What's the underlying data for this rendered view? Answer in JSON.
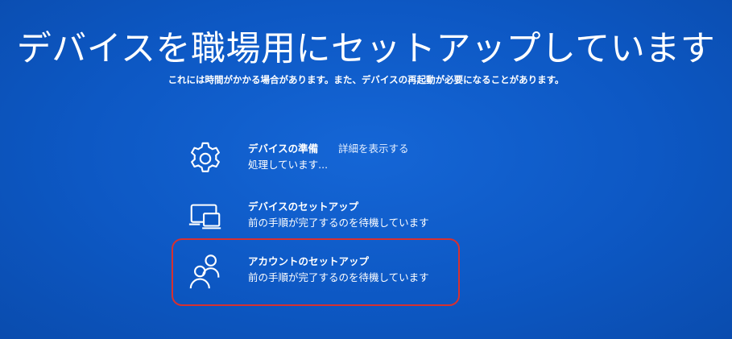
{
  "header": {
    "title": "デバイスを職場用にセットアップしています",
    "subtitle": "これには時間がかかる場合があります。また、デバイスの再起動が必要になることがあります。"
  },
  "steps": [
    {
      "icon": "gear-icon",
      "name": "デバイスの準備",
      "link": "詳細を表示する",
      "status": "処理しています..."
    },
    {
      "icon": "devices-icon",
      "name": "デバイスのセットアップ",
      "status": "前の手順が完了するのを待機しています"
    },
    {
      "icon": "people-icon",
      "name": "アカウントのセットアップ",
      "status": "前の手順が完了するのを待機しています"
    }
  ],
  "colors": {
    "background": "#0d58c4",
    "text": "#ffffff",
    "highlight": "#d8302f"
  }
}
